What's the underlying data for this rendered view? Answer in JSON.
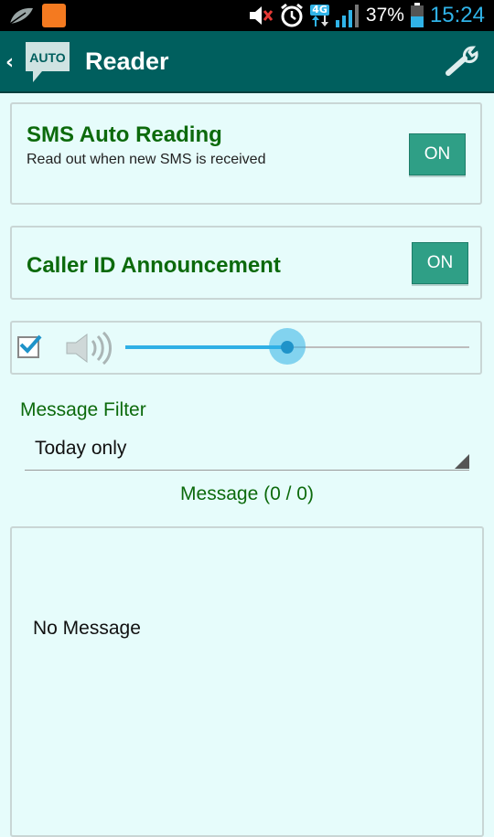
{
  "status_bar": {
    "icons": [
      "leaf-icon",
      "app-badge-icon",
      "mute-icon",
      "alarm-icon",
      "4g-icon",
      "signal-icon",
      "battery-icon"
    ],
    "network": "4G",
    "battery": "37%",
    "time": "15:24",
    "colors": {
      "time": "#30b3e8",
      "background": "#000000"
    }
  },
  "action_bar": {
    "logo_text": "AUTO",
    "title": "Reader",
    "icons": [
      "back-chevron-icon",
      "auto-logo-icon",
      "wrench-icon"
    ],
    "background": "#005f5e"
  },
  "sms_card": {
    "title": "SMS Auto Reading",
    "subtitle": "Read out when new SMS is received",
    "toggle": "ON"
  },
  "caller_card": {
    "title": "Caller ID Announcement",
    "toggle": "ON"
  },
  "volume": {
    "checked": true,
    "level": 0.47,
    "icons": [
      "checkbox-icon",
      "speaker-icon"
    ]
  },
  "filter": {
    "label": "Message Filter",
    "selected": "Today only"
  },
  "messages": {
    "count_label": "Message (0 / 0)",
    "empty_text": "No Message"
  },
  "theme": {
    "accent_green": "#0c6a0c",
    "toggle_green": "#2f9f86",
    "slider_blue": "#2fb0e6",
    "background": "#e6fcfb"
  }
}
